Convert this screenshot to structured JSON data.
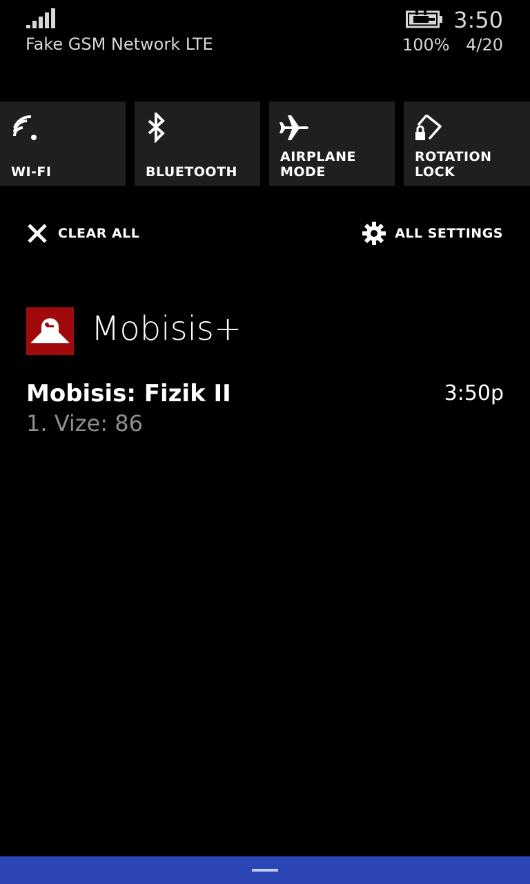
{
  "status_bar": {
    "network": "Fake GSM Network LTE",
    "battery": "100%",
    "time": "3:50",
    "date": "4/20",
    "signal_icon": "signal-bars-icon",
    "battery_icon": "battery-charging-icon"
  },
  "quick_actions": [
    {
      "label": "WI-FI",
      "icon": "wifi-icon"
    },
    {
      "label": "BLUETOOTH",
      "icon": "bluetooth-icon"
    },
    {
      "label": "AIRPLANE\nMODE",
      "icon": "airplane-icon"
    },
    {
      "label": "ROTATION LOCK",
      "icon": "rotation-lock-icon"
    }
  ],
  "actions": {
    "clear_all": "CLEAR ALL",
    "all_settings": "ALL SETTINGS"
  },
  "notification_group": {
    "app_name": "Mobisis+",
    "app_color": "#a00a0d",
    "notifications": [
      {
        "title": "Mobisis: Fizik II",
        "time": "3:50p",
        "body": "1. Vize: 86"
      }
    ]
  },
  "colors": {
    "background": "#000000",
    "tile": "#1f1f1f",
    "accent_bar": "#2a45b4",
    "secondary_text": "#8f8f8f"
  }
}
